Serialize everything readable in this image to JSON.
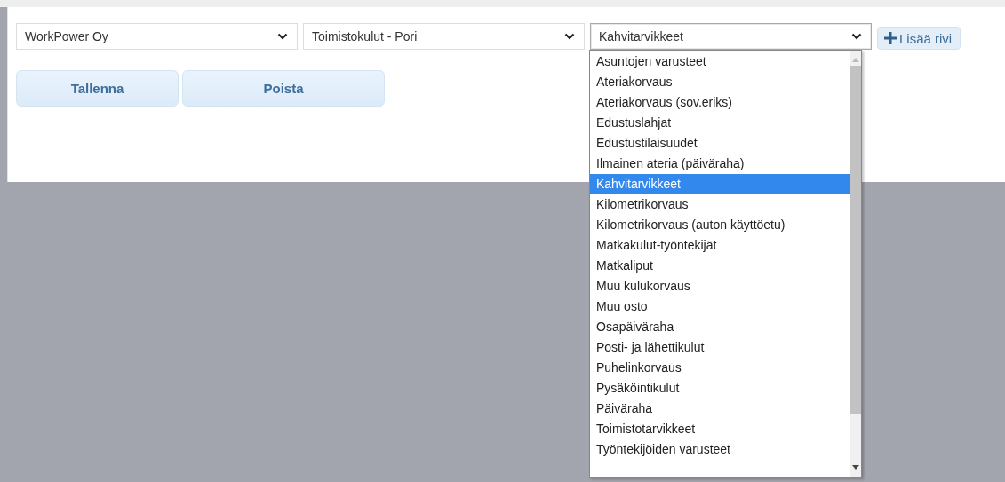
{
  "selects": [
    {
      "value": "WorkPower Oy",
      "open": false
    },
    {
      "value": "Toimistokulut - Pori",
      "open": false
    },
    {
      "value": "Kahvitarvikkeet",
      "open": true
    }
  ],
  "add_button": {
    "label": "Lisää rivi"
  },
  "buttons": [
    {
      "label": "Tallenna"
    },
    {
      "label": "Poista"
    }
  ],
  "dropdown": {
    "options": [
      {
        "label": "Asuntojen varusteet",
        "selected": false
      },
      {
        "label": "Ateriakorvaus",
        "selected": false
      },
      {
        "label": "Ateriakorvaus (sov.eriks)",
        "selected": false
      },
      {
        "label": "Edustuslahjat",
        "selected": false
      },
      {
        "label": "Edustustilaisuudet",
        "selected": false
      },
      {
        "label": "Ilmainen ateria (päiväraha)",
        "selected": false
      },
      {
        "label": "Kahvitarvikkeet",
        "selected": true
      },
      {
        "label": "Kilometrikorvaus",
        "selected": false
      },
      {
        "label": "Kilometrikorvaus (auton käyttöetu)",
        "selected": false
      },
      {
        "label": "Matkakulut-työntekijät",
        "selected": false
      },
      {
        "label": "Matkaliput",
        "selected": false
      },
      {
        "label": "Muu kulukorvaus",
        "selected": false
      },
      {
        "label": "Muu osto",
        "selected": false
      },
      {
        "label": "Osapäiväraha",
        "selected": false
      },
      {
        "label": "Posti- ja lähettikulut",
        "selected": false
      },
      {
        "label": "Puhelinkorvaus",
        "selected": false
      },
      {
        "label": "Pysäköintikulut",
        "selected": false
      },
      {
        "label": "Päiväraha",
        "selected": false
      },
      {
        "label": "Toimistotarvikkeet",
        "selected": false
      },
      {
        "label": "Työntekijöiden varusteet",
        "selected": false
      }
    ]
  }
}
